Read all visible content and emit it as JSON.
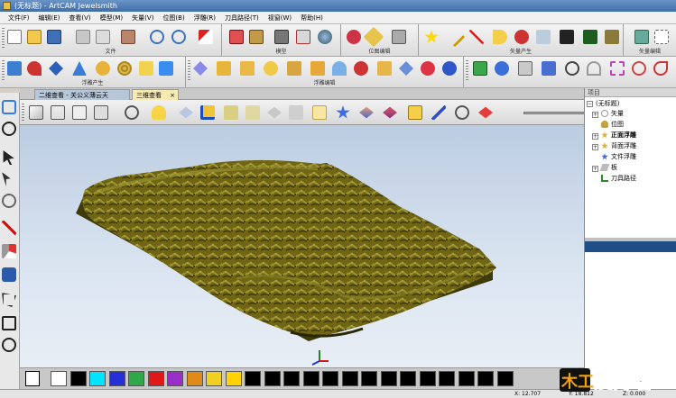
{
  "window": {
    "title": "(无标题) - ArtCAM Jewelsmith"
  },
  "menu": [
    "文件(F)",
    "编辑(E)",
    "查看(V)",
    "模型(M)",
    "矢量(V)",
    "位图(B)",
    "浮雕(R)",
    "刀具路径(T)",
    "视窗(W)",
    "帮助(H)"
  ],
  "toolbar_groups": {
    "file": "文件",
    "model": "模型",
    "bitmap": "位图编辑",
    "vector_create": "矢量产生",
    "vector_edit": "矢量编辑",
    "relief_create": "浮雕产生",
    "relief_edit": "浮雕编辑"
  },
  "tabs": [
    {
      "label": "二维查看 - 关公义薄云天",
      "active": false
    },
    {
      "label": "三维查看",
      "active": true
    }
  ],
  "tab_close": "×",
  "project": {
    "header": "项目",
    "tree": [
      "(无标题)",
      "矢量",
      "位图",
      "正面浮雕",
      "背面浮雕",
      "文件浮雕",
      "板",
      "刀具路径"
    ]
  },
  "palette": {
    "colors": [
      "#000000",
      "#ffffff",
      "#000000",
      "#00e5ff",
      "#2530d8",
      "#2fa84a",
      "#e01818",
      "#9a2ec8",
      "#e08a18",
      "#f0d020",
      "#ffd200",
      "#000000",
      "#000000",
      "#000000",
      "#000000",
      "#000000",
      "#000000",
      "#000000",
      "#000000",
      "#000000",
      "#000000",
      "#000000",
      "#000000",
      "#000000",
      "#000000"
    ]
  },
  "status": {
    "coord_x": "X: 12.707",
    "coord_y": "Y: 18.812",
    "coord_z": "Z: 0.000"
  },
  "watermark": {
    "text": "爱好者",
    "brand": "木工"
  },
  "colors": {
    "relief": "#6f6515",
    "relief_dark": "#3d3808",
    "relief_light": "#a09a35",
    "viewport_top": "#bccde2"
  },
  "icons": {
    "file": [
      "new-icon",
      "open-icon",
      "save-icon",
      "cut-icon",
      "copy-icon",
      "paste-icon",
      "undo-icon",
      "redo-icon",
      "edit-icon"
    ],
    "view": [
      "view-iso-icon",
      "view-cube-icon",
      "view-front-icon",
      "view-side-icon",
      "zoom-icon",
      "light-icon",
      "axes-icon",
      "shade-icon",
      "texture-icon"
    ]
  }
}
